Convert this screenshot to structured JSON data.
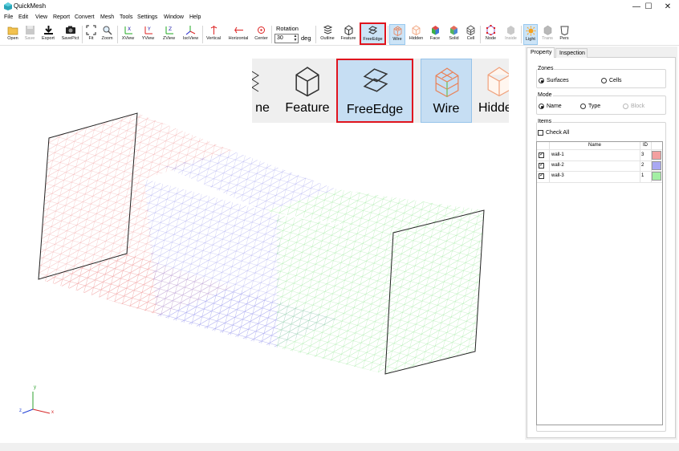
{
  "app": {
    "title": "QuickMesh"
  },
  "window_controls": {
    "minimize": "—",
    "maximize": "☐",
    "close": "✕"
  },
  "menu": [
    "File",
    "Edit",
    "View",
    "Report",
    "Convert",
    "Mesh",
    "Tools",
    "Settings",
    "Window",
    "Help"
  ],
  "toolbar": {
    "open": "Open",
    "save": "Save",
    "export": "Export",
    "savepict": "SavePict",
    "fit": "Fit",
    "zoom": "Zoom",
    "xview": "XView",
    "yview": "YView",
    "zview": "ZView",
    "isoview": "IsoView",
    "vertical": "Vertical",
    "horizontal": "Horizontal",
    "center": "Center",
    "rotation_label": "Rotation",
    "rotation_value": "30",
    "rotation_unit": "deg",
    "outline": "Outline",
    "feature": "Feature",
    "freeedge": "FreeEdge",
    "wire": "Wire",
    "hidden": "Hidden",
    "face": "Face",
    "solid": "Solid",
    "cell": "Cell",
    "node": "Node",
    "inside": "Inside",
    "light": "Light",
    "trans": "Trans",
    "pers": "Pers"
  },
  "zoom_callout": {
    "partial_left": "ne",
    "feature": "Feature",
    "freeedge": "FreeEdge",
    "wire": "Wire",
    "partial_right": "Hidde"
  },
  "axes": {
    "x": "x",
    "y": "y",
    "z": "z"
  },
  "colors": {
    "wall1": "#f3a0a0",
    "wall2": "#a9a8f3",
    "wall3": "#a3efa3",
    "highlight": "#e0141e",
    "active": "#cce4f7"
  },
  "panel": {
    "tabs": [
      "Property",
      "Inspection"
    ],
    "zones": {
      "title": "Zones",
      "surfaces": "Surfaces",
      "cells": "Cells"
    },
    "mode": {
      "title": "Mode",
      "name": "Name",
      "type": "Type",
      "block": "Block"
    },
    "items": {
      "title": "Items",
      "check_all": "Check All",
      "columns": {
        "name": "Name",
        "id": "ID"
      },
      "rows": [
        {
          "name": "wall-1",
          "id": "3",
          "checked": true,
          "color": "#f3a0a0"
        },
        {
          "name": "wall-2",
          "id": "2",
          "checked": true,
          "color": "#a9a8f3"
        },
        {
          "name": "wall-3",
          "id": "1",
          "checked": true,
          "color": "#a3efa3"
        }
      ]
    }
  }
}
